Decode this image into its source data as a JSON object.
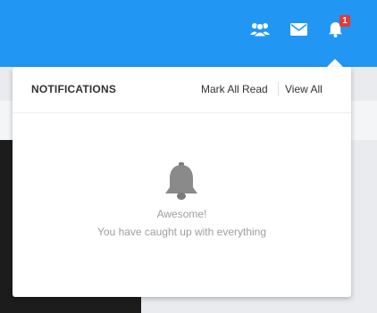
{
  "header": {
    "icons": [
      "users-icon",
      "envelope-icon",
      "bell-icon"
    ],
    "notification_count": "1",
    "colors": {
      "bar": "#2196f3",
      "badge": "#e53935"
    }
  },
  "notifications": {
    "title": "NOTIFICATIONS",
    "mark_all_read_label": "Mark All Read",
    "view_all_label": "View All",
    "empty_icon": "bell-icon",
    "empty_title": "Awesome!",
    "empty_message": "You have caught up with everything"
  }
}
